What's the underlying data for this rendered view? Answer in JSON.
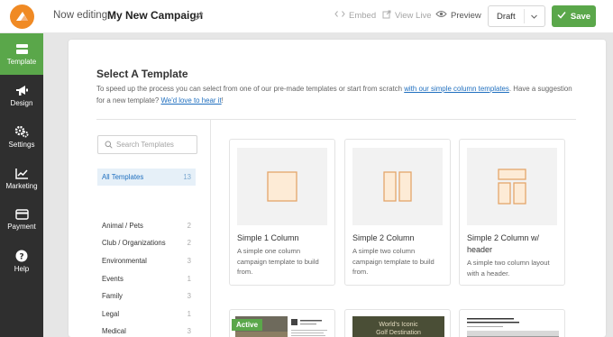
{
  "header": {
    "editing_label": "Now editing",
    "campaign_name": "My New Campaign",
    "embed_label": "Embed",
    "view_live_label": "View Live",
    "preview_label": "Preview",
    "status_value": "Draft",
    "save_label": "Save"
  },
  "sidebar": {
    "items": [
      {
        "label": "Template",
        "icon": "template-icon",
        "active": true
      },
      {
        "label": "Design",
        "icon": "megaphone-icon"
      },
      {
        "label": "Settings",
        "icon": "gears-icon"
      },
      {
        "label": "Marketing",
        "icon": "chart-icon"
      },
      {
        "label": "Payment",
        "icon": "credit-card-icon"
      },
      {
        "label": "Help",
        "icon": "help-icon"
      }
    ]
  },
  "panel": {
    "title": "Select A Template",
    "desc_part1": "To speed up the process you can select from one of our pre-made templates or start from scratch ",
    "desc_link1": "with our simple column templates",
    "desc_part2": ". Have a suggestion for a new template? ",
    "desc_link2": "We'd love to hear it",
    "desc_part3": "!",
    "search_placeholder": "Search Templates",
    "all_templates": {
      "label": "All Templates",
      "count": "13"
    },
    "categories": [
      {
        "label": "Animal / Pets",
        "count": "2"
      },
      {
        "label": "Club / Organizations",
        "count": "2"
      },
      {
        "label": "Environmental",
        "count": "3"
      },
      {
        "label": "Events",
        "count": "1"
      },
      {
        "label": "Family",
        "count": "3"
      },
      {
        "label": "Legal",
        "count": "1"
      },
      {
        "label": "Medical",
        "count": "3"
      }
    ]
  },
  "templates": [
    {
      "title": "Simple 1 Column",
      "desc": "A simple one column campaign template to build from."
    },
    {
      "title": "Simple 2 Column",
      "desc": "A simple two column campaign template to build from."
    },
    {
      "title": "Simple 2 Column w/ header",
      "desc": "A simple two column layout with a header."
    }
  ],
  "second_row": {
    "badge": "Active",
    "thumb2_caption_line1": "World's Iconic",
    "thumb2_caption_line2": "Golf Destination"
  },
  "colors": {
    "accent_green": "#5aa74a",
    "logo_orange": "#f08a24",
    "sidebar_bg": "#2f2f2f",
    "link_blue": "#1f6fbf",
    "thumb_stroke": "#e4a56a",
    "thumb_fill": "#fdebd6"
  }
}
